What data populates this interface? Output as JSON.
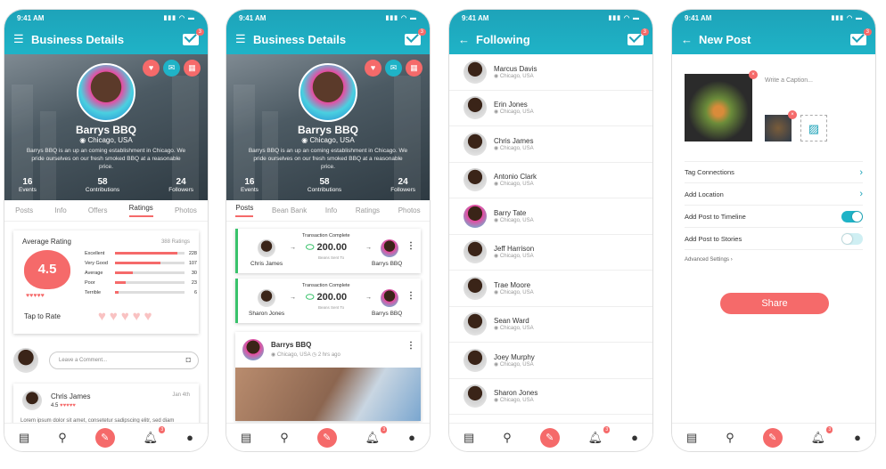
{
  "status_time": "9:41 AM",
  "colors": {
    "teal": "#1ea3b9",
    "coral": "#f56a6a",
    "green": "#39c36b"
  },
  "nav_badge": "3",
  "mail_badge": "3",
  "screen1": {
    "title": "Business Details",
    "name": "Barrys BBQ",
    "location": "Chicago, USA",
    "description": "Barrys BBQ is an up an coming establishment in Chicago. We pride ourselves on our fresh smoked BBQ at a reasonable price.",
    "stats": [
      {
        "value": "16",
        "label": "Events"
      },
      {
        "value": "58",
        "label": "Contributions"
      },
      {
        "value": "24",
        "label": "Followers"
      }
    ],
    "tabs": [
      "Posts",
      "Info",
      "Offers",
      "Ratings",
      "Photos"
    ],
    "rating_title": "Average Rating",
    "rating_total": "388 Ratings",
    "rating_value": "4.5",
    "rating_rows": [
      {
        "label": "Excellent",
        "count": "228",
        "fill": 0.9
      },
      {
        "label": "Very Good",
        "count": "107",
        "fill": 0.65
      },
      {
        "label": "Average",
        "count": "30",
        "fill": 0.25
      },
      {
        "label": "Poor",
        "count": "23",
        "fill": 0.15
      },
      {
        "label": "Terrible",
        "count": "6",
        "fill": 0.05
      }
    ],
    "tap_to_rate": "Tap to Rate",
    "comment_placeholder": "Leave a Comment...",
    "review_name": "Chris James",
    "review_date": "Jan 4th",
    "review_score": "4.5",
    "review_text": "Lorem ipsum dolor sit amet, consetetur sadipscing elitr, sed diam"
  },
  "screen2": {
    "title": "Business Details",
    "name": "Barrys BBQ",
    "location": "Chicago, USA",
    "description": "Barrys BBQ is an up an coming establishment in Chicago. We pride ourselves on our fresh smoked BBQ at a reasonable price.",
    "stats": [
      {
        "value": "16",
        "label": "Events"
      },
      {
        "value": "58",
        "label": "Contributions"
      },
      {
        "value": "24",
        "label": "Followers"
      }
    ],
    "tabs": [
      "Posts",
      "Bean Bank",
      "Info",
      "Ratings",
      "Photos"
    ],
    "transactions": [
      {
        "header": "Transaction Complete",
        "from": "Chris James",
        "amount": "200.00",
        "sub": "Beans Sent To",
        "to": "Barrys BBQ"
      },
      {
        "header": "Transaction Complete",
        "from": "Sharon Jones",
        "amount": "200.00",
        "sub": "Beans Sent To",
        "to": "Barrys BBQ"
      }
    ],
    "post_name": "Barrys BBQ",
    "post_location": "Chicago, USA",
    "post_time": "2 hrs ago"
  },
  "screen3": {
    "title": "Following",
    "people": [
      {
        "name": "Marcus Davis",
        "location": "Chicago, USA"
      },
      {
        "name": "Erin Jones",
        "location": "Chicago, USA"
      },
      {
        "name": "Chris James",
        "location": "Chicago, USA"
      },
      {
        "name": "Antonio Clark",
        "location": "Chicago, USA"
      },
      {
        "name": "Barry Tate",
        "location": "Chicago, USA"
      },
      {
        "name": "Jeff Harrison",
        "location": "Chicago, USA"
      },
      {
        "name": "Trae Moore",
        "location": "Chicago, USA"
      },
      {
        "name": "Sean Ward",
        "location": "Chicago, USA"
      },
      {
        "name": "Joey Murphy",
        "location": "Chicago, USA"
      },
      {
        "name": "Sharon Jones",
        "location": "Chicago, USA"
      }
    ]
  },
  "screen4": {
    "title": "New Post",
    "caption_placeholder": "Write a Caption...",
    "options": [
      "Tag Connections",
      "Add Location",
      "Add Post to Timeline",
      "Add Post to Stories"
    ],
    "timeline_on": true,
    "stories_on": false,
    "advanced": "Advanced Settings",
    "share": "Share"
  }
}
